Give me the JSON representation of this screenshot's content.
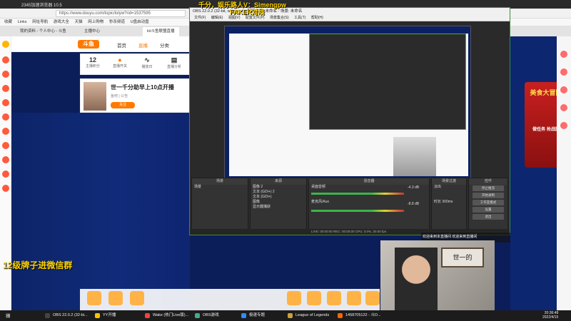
{
  "browser": {
    "title": "2345加速浏览器 10.5",
    "url": "https://www.douyu.com/topic/lolyw?rid=1537595",
    "bookmarks": [
      "收藏",
      "Links",
      "网址导航",
      "游戏大全",
      "天猫",
      "网上购物",
      "秒杀频道",
      "U盘启动盘"
    ],
    "tabs": [
      "我的资料 - 个人中心 - 斗鱼",
      "主播中心",
      "lol斗鱼联盟直播"
    ]
  },
  "douyu": {
    "nav": [
      "首页",
      "直播",
      "分类"
    ],
    "stats": [
      {
        "value": "12",
        "label": "主播积分"
      },
      {
        "value": "",
        "label": "直播开关"
      },
      {
        "value": "",
        "label": "播放日"
      },
      {
        "value": "",
        "label": "直播分析"
      }
    ],
    "streamer": {
      "title": "世一千分助早上10点开播",
      "meta": "鱼吧 | 公告",
      "follow": "关注"
    },
    "overlay_text": "12级牌子进微信群",
    "promo_title": "美食大冒险",
    "promo_sub": "做任务 抢战旗"
  },
  "obs": {
    "title": "OBS 22.0.2 (32-bit, windows) - 配置文件: 未命名 - 场景: 未命名",
    "menu": [
      "文件(F)",
      "编辑(E)",
      "视图(V)",
      "配置文件(P)",
      "场景集合(S)",
      "工具(T)",
      "帮助(H)"
    ],
    "headline1": "千分，娱乐路人V：Simengpw",
    "headline2": "FAKER对线",
    "docks": {
      "scenes": {
        "title": "场景",
        "items": [
          "场景"
        ]
      },
      "sources": {
        "title": "来源",
        "items": [
          "图像 2",
          "文本 (GDI+) 2",
          "文本 (GDI+)",
          "图像",
          "显示器捕获"
        ]
      },
      "mixer": {
        "title": "混音器",
        "tracks": [
          {
            "name": "桌面音频",
            "db": "-4.3 dB"
          },
          {
            "name": "麦克风/Aux",
            "db": "-8.8 dB"
          }
        ]
      },
      "transitions": {
        "title": "场景过渡",
        "type": "淡出",
        "duration_label": "时长",
        "duration": "300ms"
      },
      "controls": {
        "title": "控件",
        "buttons": [
          "停止推流",
          "开始录制",
          "工作室模式",
          "设置",
          "退出"
        ]
      }
    },
    "status": "LIVE: 00:00:00   REC: 00:00:00   CPU: 3.0%, 30.00 fps"
  },
  "chat": {
    "text": "欢迎来到本直播间 欢迎来到直播间"
  },
  "webcam": {
    "sign": "世一的"
  },
  "taskbar": {
    "items": [
      {
        "label": "OBS 22.0.2 (32-bi...",
        "color": "#444444"
      },
      {
        "label": "YY开播",
        "color": "#f5c400"
      },
      {
        "label": "Wake (热门Live版)...",
        "color": "#e44"
      },
      {
        "label": "OBS游戏",
        "color": "#4a8"
      },
      {
        "label": "极速专题",
        "color": "#38f"
      },
      {
        "label": "League of Legends",
        "color": "#c9a23a"
      },
      {
        "label": "1458705122 - 斗D...",
        "color": "#f60"
      }
    ],
    "time": "20:36:48",
    "date": "2022/4/15"
  }
}
